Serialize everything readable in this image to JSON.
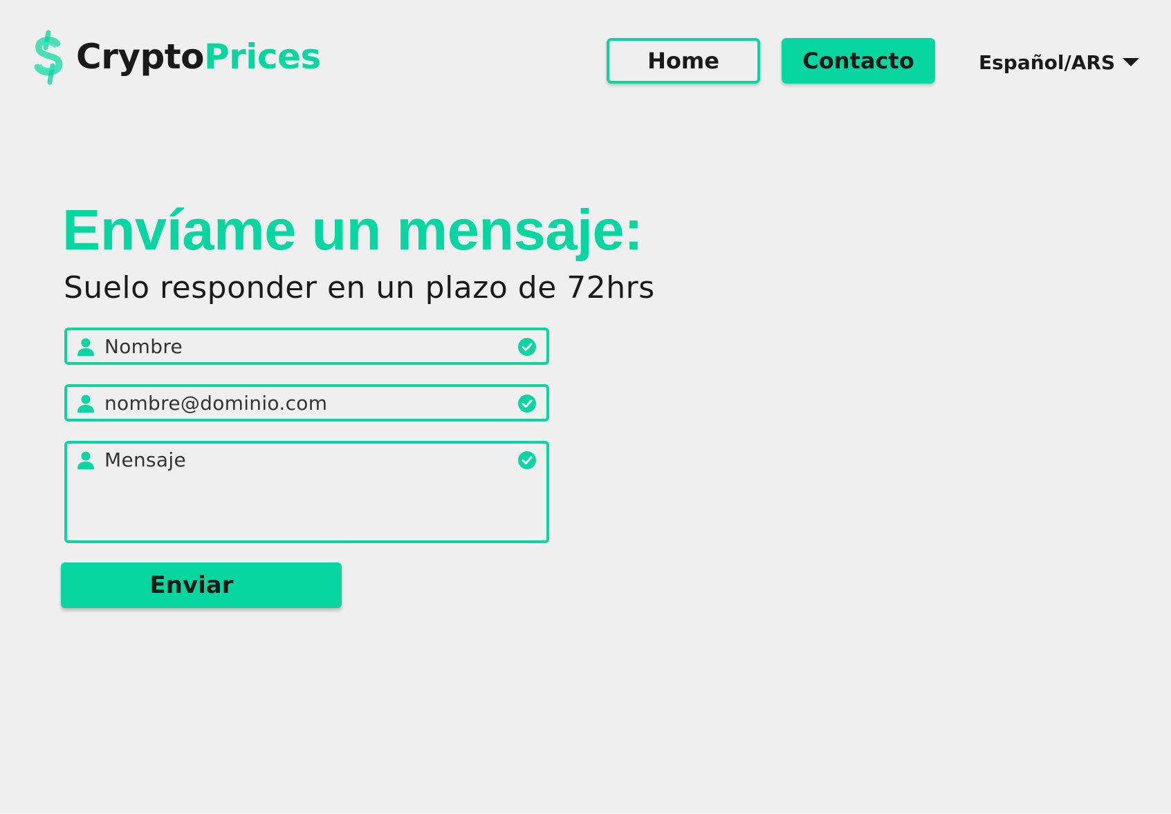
{
  "colors": {
    "accent": "#08d6a0",
    "page_background": "#efefef",
    "text": "#1a1a1a"
  },
  "header": {
    "logo": {
      "icon": "dollar-sign-icon",
      "text_part_1": "Crypto",
      "text_part_2": "Prices"
    },
    "nav": {
      "home_label": "Home",
      "contact_label": "Contacto"
    },
    "language": {
      "selected": "Español/ARS",
      "icon": "caret-down-icon"
    }
  },
  "main": {
    "title": "Envíame un mensaje:",
    "subtitle": "Suelo responder en un plazo de 72hrs",
    "form": {
      "fields": [
        {
          "placeholder": "Nombre",
          "icon": "user-icon",
          "status_icon": "check-circle-icon"
        },
        {
          "placeholder": "nombre@dominio.com",
          "icon": "user-icon",
          "status_icon": "check-circle-icon"
        },
        {
          "placeholder": "Mensaje",
          "icon": "user-icon",
          "status_icon": "check-circle-icon"
        }
      ],
      "submit_label": "Enviar"
    }
  }
}
